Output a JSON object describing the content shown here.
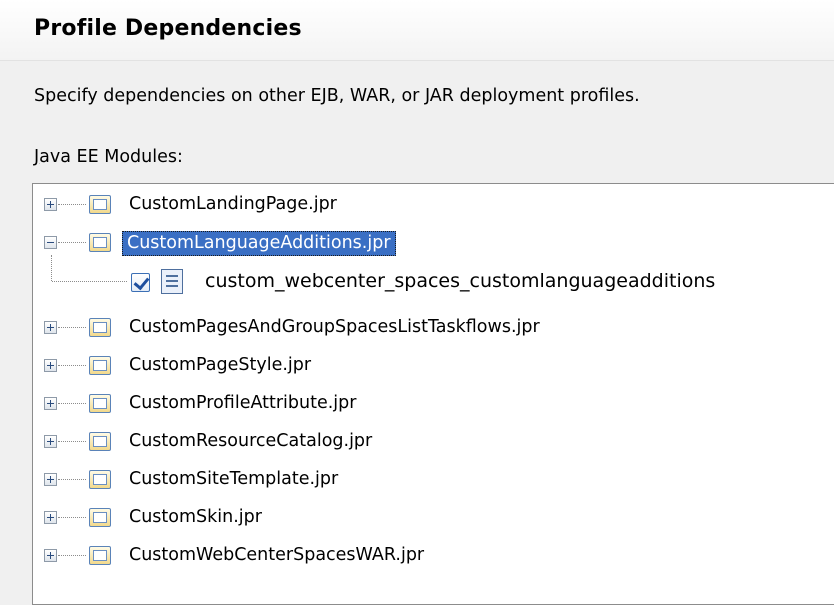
{
  "header": {
    "title": "Profile Dependencies"
  },
  "description": "Specify dependencies on other EJB, WAR, or JAR deployment profiles.",
  "modules_label": {
    "mnemonic": "J",
    "rest": "ava EE Modules:"
  },
  "tree": {
    "items": [
      {
        "label": "CustomLandingPage.jpr",
        "expanded": false,
        "selected": false
      },
      {
        "label": "CustomLanguageAdditions.jpr",
        "expanded": true,
        "selected": true,
        "children": [
          {
            "label": "custom_webcenter_spaces_customlanguageadditions",
            "checked": true
          }
        ]
      },
      {
        "label": "CustomPagesAndGroupSpacesListTaskflows.jpr",
        "expanded": false,
        "selected": false
      },
      {
        "label": "CustomPageStyle.jpr",
        "expanded": false,
        "selected": false
      },
      {
        "label": "CustomProfileAttribute.jpr",
        "expanded": false,
        "selected": false
      },
      {
        "label": "CustomResourceCatalog.jpr",
        "expanded": false,
        "selected": false
      },
      {
        "label": "CustomSiteTemplate.jpr",
        "expanded": false,
        "selected": false
      },
      {
        "label": "CustomSkin.jpr",
        "expanded": false,
        "selected": false
      },
      {
        "label": "CustomWebCenterSpacesWAR.jpr",
        "expanded": false,
        "selected": false
      }
    ]
  },
  "icons": {
    "folder": "folder-icon",
    "document": "document-icon",
    "expand": "plus-icon",
    "collapse": "minus-icon"
  },
  "colors": {
    "selection": "#3a6fc4",
    "folder_border": "#5a83b8"
  }
}
